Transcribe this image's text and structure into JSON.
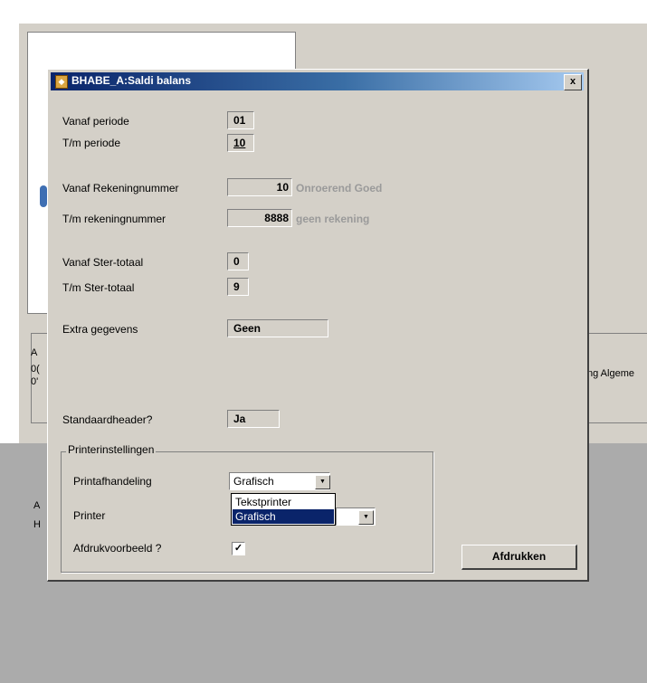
{
  "background": {
    "partial_text_1": "A",
    "partial_text_2": "0(",
    "partial_text_3": "0'",
    "partial_text_4": "ng Algeme",
    "partial_text_5": "A",
    "partial_text_6": "H"
  },
  "dialog": {
    "title": "BHABE_A:Saldi balans",
    "close_label": "x",
    "fields": {
      "vanaf_periode": {
        "label": "Vanaf periode",
        "value": "01"
      },
      "tm_periode": {
        "label": "T/m periode",
        "value": "10"
      },
      "vanaf_rekeningnummer": {
        "label": "Vanaf Rekeningnummer",
        "value": "10",
        "description": "Onroerend Goed"
      },
      "tm_rekeningnummer": {
        "label": "T/m rekeningnummer",
        "value": "8888",
        "description": "geen rekening"
      },
      "vanaf_ster_totaal": {
        "label": "Vanaf Ster-totaal",
        "value": "0"
      },
      "tm_ster_totaal": {
        "label": "T/m Ster-totaal",
        "value": "9"
      },
      "extra_gegevens": {
        "label": "Extra gegevens",
        "value": "Geen"
      },
      "standaardheader": {
        "label": "Standaardheader?",
        "value": "Ja"
      }
    },
    "printer_settings": {
      "legend": "Printerinstellingen",
      "printafhandeling": {
        "label": "Printafhandeling",
        "value": "Grafisch",
        "options": [
          "Tekstprinter",
          "Grafisch"
        ],
        "highlighted_option": "Grafisch"
      },
      "printer": {
        "label": "Printer",
        "value": ""
      },
      "afdrukvoorbeeld": {
        "label": "Afdrukvoorbeeld ?",
        "checked": true,
        "check_glyph": "✓"
      }
    },
    "print_button": "Afdrukken"
  },
  "colors": {
    "title_gradient_start": "#0a246a",
    "title_gradient_end": "#a6caf0",
    "dialog_face": "#d4d0c8",
    "selection": "#0a246a"
  }
}
